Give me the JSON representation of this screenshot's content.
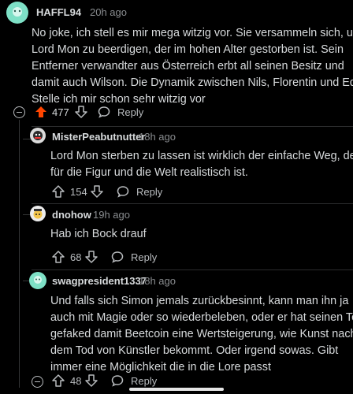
{
  "comments": [
    {
      "username": "HAFFL94",
      "time": "20h ago",
      "lines": [
        "No joke, ich stell es mir mega witzig vor. Sie versammeln sich, um",
        "Lord Mon zu beerdigen, der im hohen Alter gestorben ist. Sein",
        "Entferner verwandter aus Österreich erbt all seinen Besitz und",
        "damit auch Wilson. Die Dynamik zwischen Nils, Florentin und Eddy",
        "Stelle ich mir schon sehr witzig vor"
      ],
      "votes": "477",
      "reply": "Reply"
    },
    {
      "username": "MisterPeabutnutter",
      "time": "18h ago",
      "lines": [
        "Lord Mon sterben zu lassen ist wirklich der einfache Weg, der",
        "für die Figur und die Welt realistisch ist."
      ],
      "votes": "154",
      "reply": "Reply"
    },
    {
      "username": "dnohow",
      "time": "19h ago",
      "lines": [
        "Hab ich Bock drauf"
      ],
      "votes": "68",
      "reply": "Reply"
    },
    {
      "username": "swagpresident1337",
      "time": "18h ago",
      "lines": [
        "Und falls sich Simon jemals zurückbesinnt, kann man ihn ja",
        "auch mit Magie oder so wiederbeleben, oder er hat seinen Tod",
        "gefaked damit Beetcoin eine Wertsteigerung, wie Kunst nach",
        "dem Tod von Künstler bekommt. Oder irgend sowas. Gibt",
        "immer eine Möglichkeit die in die Lore passt"
      ],
      "votes": "48",
      "reply": "Reply"
    }
  ],
  "colors": {
    "upvote_active": "#ff4500",
    "text": "#d7dadc",
    "meta": "#8a8d90"
  },
  "icons": [
    "collapse-icon",
    "upvote-icon",
    "downvote-icon",
    "reply-icon"
  ]
}
